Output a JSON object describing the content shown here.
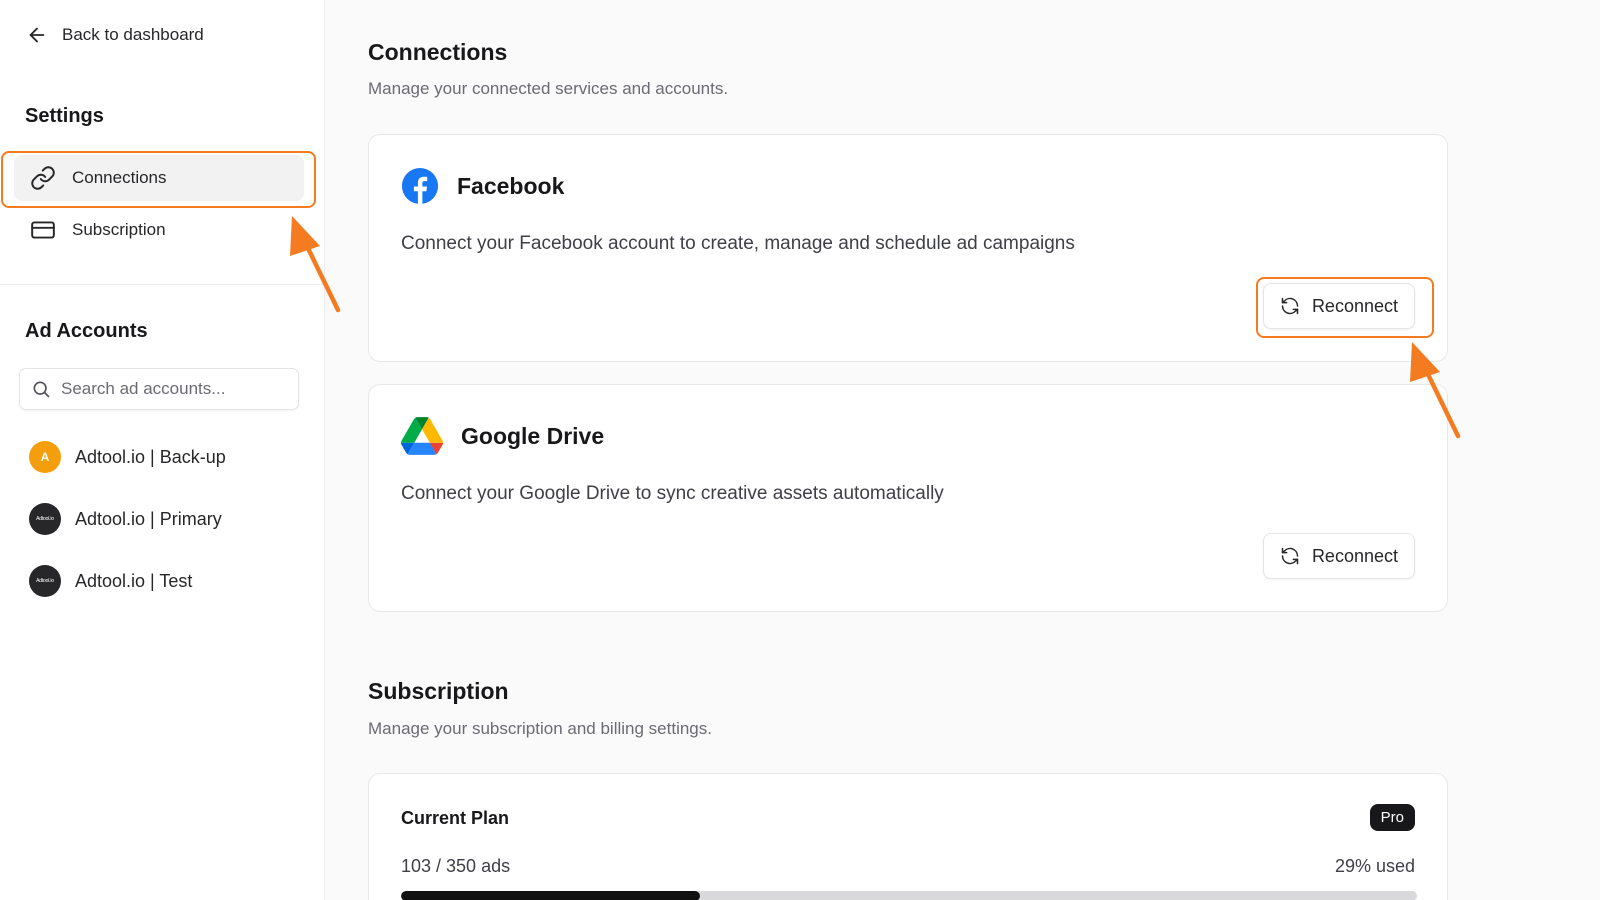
{
  "sidebar": {
    "back_label": "Back to dashboard",
    "settings_title": "Settings",
    "nav": [
      {
        "label": "Connections",
        "icon": "link-icon",
        "active": true
      },
      {
        "label": "Subscription",
        "icon": "credit-card-icon",
        "active": false
      }
    ],
    "ad_accounts_title": "Ad Accounts",
    "search_placeholder": "Search ad accounts...",
    "accounts": [
      {
        "label": "Adtool.io | Back-up",
        "avatar_text": "A",
        "avatar_color": "#f59e0b"
      },
      {
        "label": "Adtool.io | Primary",
        "avatar_text": "Adtool.io",
        "avatar_color": "#27272a"
      },
      {
        "label": "Adtool.io | Test",
        "avatar_text": "Adtool.io",
        "avatar_color": "#27272a"
      }
    ]
  },
  "connections": {
    "title": "Connections",
    "subtitle": "Manage your connected services and accounts.",
    "services": [
      {
        "name": "Facebook",
        "icon": "facebook-icon",
        "description": "Connect your Facebook account to create, manage and schedule ad campaigns",
        "button_label": "Reconnect"
      },
      {
        "name": "Google Drive",
        "icon": "google-drive-icon",
        "description": "Connect your Google Drive to sync creative assets automatically",
        "button_label": "Reconnect"
      }
    ]
  },
  "subscription": {
    "title": "Subscription",
    "subtitle": "Manage your subscription and billing settings.",
    "plan_label": "Current Plan",
    "plan_badge": "Pro",
    "usage_text": "103 / 350 ads",
    "usage_percent_text": "29% used",
    "usage_fraction": 0.294
  },
  "colors": {
    "highlight": "#f47b20",
    "facebook_blue": "#1877f2"
  }
}
